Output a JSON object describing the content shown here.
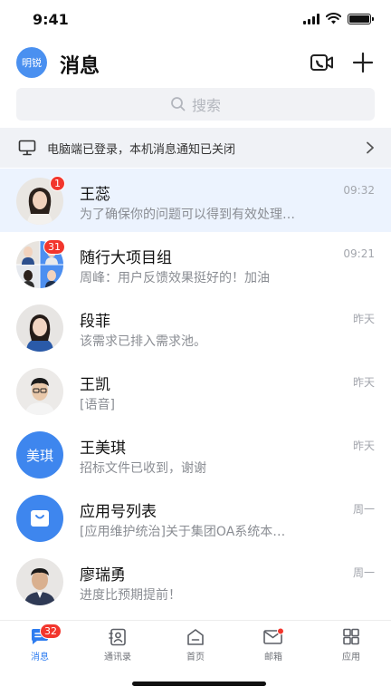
{
  "status_bar": {
    "time": "9:41"
  },
  "header": {
    "avatar_text": "明锐",
    "title": "消息"
  },
  "search": {
    "placeholder": "搜索"
  },
  "notice": {
    "text": "电脑端已登录，本机消息通知已关闭"
  },
  "chats": [
    {
      "name": "王蕊",
      "preview": "为了确保你的问题可以得到有效处理…",
      "time": "09:32",
      "badge": "1"
    },
    {
      "name": "随行大项目组",
      "preview": "周峰：用户反馈效果挺好的！加油",
      "time": "09:21",
      "badge": "31"
    },
    {
      "name": "段菲",
      "preview": "该需求已排入需求池。",
      "time": "昨天"
    },
    {
      "name": "王凯",
      "preview": "[语音]",
      "time": "昨天"
    },
    {
      "name": "王美琪",
      "preview": "招标文件已收到，谢谢",
      "time": "昨天",
      "avatar_text": "美琪"
    },
    {
      "name": "应用号列表",
      "preview": "[应用维护统治]关于集团OA系统本…",
      "time": "周一"
    },
    {
      "name": "廖瑞勇",
      "preview": "进度比预期提前！",
      "time": "周一"
    }
  ],
  "tabs": [
    {
      "label": "消息",
      "badge": "32"
    },
    {
      "label": "通讯录"
    },
    {
      "label": "首页"
    },
    {
      "label": "邮箱"
    },
    {
      "label": "应用"
    }
  ],
  "colors": {
    "accent": "#2d7cf0",
    "badge": "#f2362d",
    "highlight_row": "#ecf3fe"
  }
}
